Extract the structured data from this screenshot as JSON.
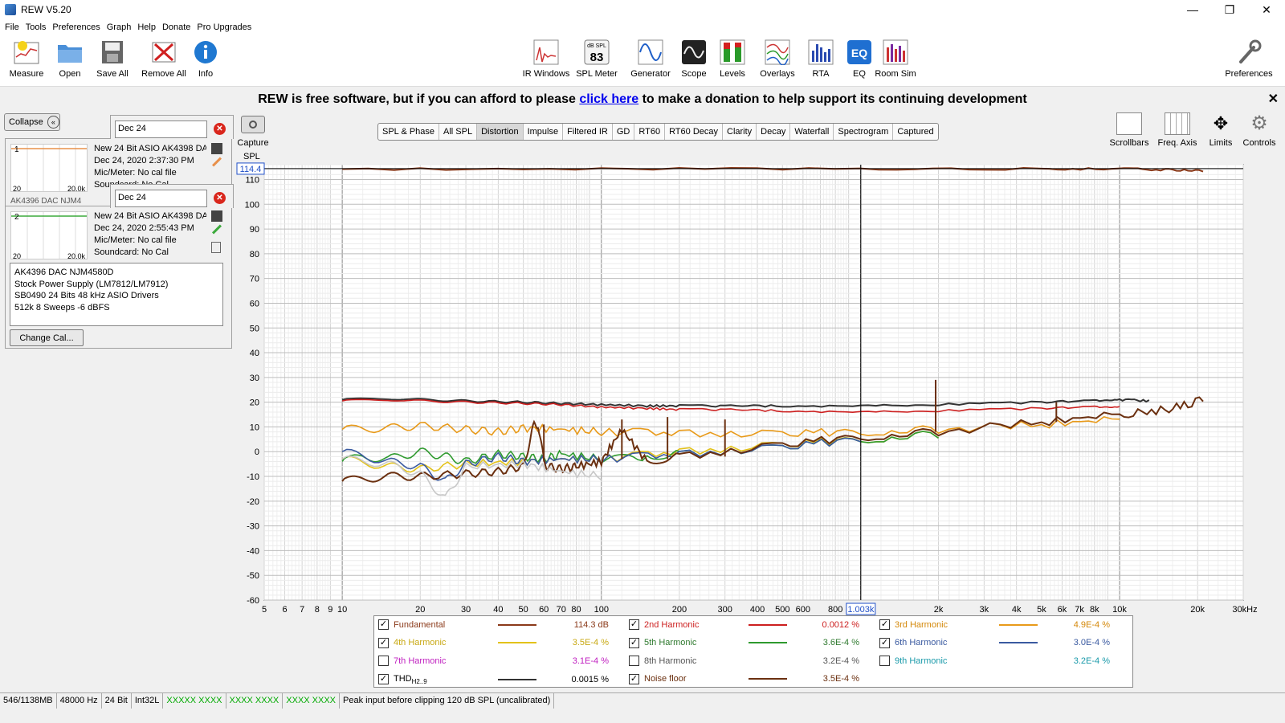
{
  "window": {
    "title": "REW V5.20",
    "controls": [
      "—",
      "❐",
      "✕"
    ]
  },
  "menu": [
    "File",
    "Tools",
    "Preferences",
    "Graph",
    "Help",
    "Donate",
    "Pro Upgrades"
  ],
  "toolbar_left": [
    "Measure",
    "Open",
    "Save All",
    "Remove All",
    "Info"
  ],
  "toolbar_center": [
    "IR Windows",
    "SPL Meter",
    "Generator",
    "Scope",
    "Levels",
    "Overlays",
    "RTA",
    "EQ",
    "Room Sim"
  ],
  "spl_meter_icon": {
    "unit": "dB SPL",
    "value": "83"
  },
  "preferences_label": "Preferences",
  "banner": {
    "before": "REW is free software, but if you can afford to please ",
    "link": "click here",
    "after": " to make a donation to help support its continuing development",
    "close": "✕"
  },
  "panel": {
    "collapse_label": "Collapse",
    "measurements": [
      {
        "name": "Dec 24",
        "index": "1",
        "thumb_min": "20",
        "thumb_max": "20.0k",
        "lines": [
          "New 24 Bit ASIO AK4398 DA",
          "Dec 24, 2020 2:37:30 PM",
          "Mic/Meter: No cal file",
          "Soundcard: No Cal"
        ],
        "trace_color": "#e8904a",
        "peek": "AK4396 DAC NJM4"
      },
      {
        "name": "Dec 24",
        "index": "2",
        "thumb_min": "20",
        "thumb_max": "20.0k",
        "lines": [
          "New 24 Bit ASIO AK4398 DA",
          "Dec 24, 2020 2:55:43 PM",
          "Mic/Meter: No cal file",
          "Soundcard: No Cal"
        ],
        "trace_color": "#3caa3c"
      }
    ],
    "notes": [
      "AK4396 DAC NJM4580D",
      "Stock Power Supply (LM7812/LM7912)",
      "SB0490 24 Bits 48 kHz ASIO Drivers",
      "512k 8 Sweeps -6 dBFS"
    ],
    "change_cal_label": "Change Cal..."
  },
  "capture_label": "Capture",
  "graph_tabs": [
    "SPL & Phase",
    "All SPL",
    "Distortion",
    "Impulse",
    "Filtered IR",
    "GD",
    "RT60",
    "RT60 Decay",
    "Clarity",
    "Decay",
    "Waterfall",
    "Spectrogram",
    "Captured"
  ],
  "active_tab": "Distortion",
  "right_tools": [
    "Scrollbars",
    "Freq. Axis",
    "Limits",
    "Controls"
  ],
  "chart_data": {
    "type": "line",
    "ylabel": "SPL",
    "xlim": [
      5,
      30000
    ],
    "ylim": [
      -60,
      116
    ],
    "xscale": "log",
    "x_ticks": [
      "5",
      "6",
      "7",
      "8",
      "9",
      "10",
      "20",
      "30",
      "40",
      "50",
      "60",
      "70",
      "80",
      "100",
      "200",
      "300",
      "400",
      "500",
      "600",
      "800",
      "2k",
      "3k",
      "4k",
      "5k",
      "6k",
      "7k",
      "8k",
      "10k",
      "20k",
      "30kHz"
    ],
    "x_tick_values": [
      5,
      6,
      7,
      8,
      9,
      10,
      20,
      30,
      40,
      50,
      60,
      70,
      80,
      100,
      200,
      300,
      400,
      500,
      600,
      800,
      2000,
      3000,
      4000,
      5000,
      6000,
      7000,
      8000,
      10000,
      20000,
      30000
    ],
    "y_ticks": [
      110,
      100,
      90,
      80,
      70,
      60,
      50,
      40,
      30,
      20,
      10,
      0,
      -10,
      -20,
      -30,
      -40,
      -50,
      -60
    ],
    "cursor": {
      "x": 1003,
      "x_label": "1.003k",
      "y": 114.4,
      "y_label": "114.4"
    },
    "grid": true,
    "series": [
      {
        "name": "Fundamental",
        "color": "#8b3a1a",
        "x": [
          10,
          100,
          1000,
          5000,
          10000,
          15000,
          21000
        ],
        "y": [
          114.2,
          114.3,
          114.3,
          114.3,
          114.3,
          114.0,
          113.4
        ]
      },
      {
        "name": "THD",
        "color": "#333333",
        "x": [
          10,
          15,
          20,
          30,
          50,
          70,
          100,
          150,
          200,
          300,
          500,
          1000,
          2000,
          5000,
          8000,
          10000,
          13000
        ],
        "y": [
          21,
          21.5,
          21,
          20.5,
          20,
          19.5,
          19,
          18.5,
          18.5,
          18.5,
          18.5,
          18.5,
          19,
          20,
          20.5,
          21,
          20.5
        ]
      },
      {
        "name": "2nd Harmonic",
        "color": "#cc1f1f",
        "x": [
          10,
          15,
          20,
          30,
          50,
          70,
          100,
          150,
          200,
          300,
          500,
          1000,
          2000,
          5000,
          8000,
          10000
        ],
        "y": [
          20.5,
          21,
          20.5,
          20,
          19.5,
          19,
          18,
          17.5,
          17,
          17,
          16.5,
          16,
          16.5,
          17.5,
          18,
          18
        ]
      },
      {
        "name": "3rd Harmonic",
        "color": "#e89a1a",
        "x": [
          10,
          15,
          20,
          30,
          40,
          50,
          70,
          100,
          200,
          500,
          1000,
          2000,
          5000,
          10000
        ],
        "y": [
          9,
          9.5,
          10.5,
          9,
          8,
          9.5,
          9,
          8,
          7.5,
          7.5,
          8,
          9,
          11,
          13
        ]
      },
      {
        "name": "4th Harmonic",
        "color": "#e3c21a",
        "x": [
          10,
          15,
          20,
          30,
          50,
          70,
          100,
          200,
          500,
          1000,
          2000
        ],
        "y": [
          -3,
          -6,
          -7,
          -5,
          -4,
          -3,
          -3,
          0,
          3,
          5,
          7
        ]
      },
      {
        "name": "5th Harmonic",
        "color": "#2f9a2f",
        "x": [
          10,
          12,
          15,
          20,
          25,
          30,
          40,
          50,
          60,
          70,
          100,
          150,
          200,
          500,
          1000,
          2000
        ],
        "y": [
          -4,
          -2,
          -3,
          0,
          -2,
          -4,
          -1,
          -2,
          -3,
          -1,
          -3,
          -2,
          -1,
          2,
          5,
          7
        ]
      },
      {
        "name": "6th Harmonic",
        "color": "#3a5aa0",
        "x": [
          10,
          15,
          20,
          25,
          30,
          40,
          50,
          70,
          100,
          200,
          500,
          1000
        ],
        "y": [
          0,
          -4,
          -6,
          -12,
          -5,
          -2,
          -4,
          -3,
          -3,
          -1,
          2,
          5
        ]
      },
      {
        "name": "Noise floor",
        "color": "#6b3010",
        "x": [
          10,
          12,
          15,
          20,
          30,
          40,
          50,
          55,
          57,
          60,
          62,
          70,
          80,
          100,
          120,
          150,
          200,
          500,
          1000,
          2000,
          5000,
          10000,
          15000,
          21000
        ],
        "y": [
          -12,
          -11,
          -10,
          -10,
          -9,
          -8,
          -6,
          11,
          11,
          -4,
          -6,
          -7,
          -6,
          -4,
          9,
          -4,
          -2,
          3,
          6,
          8,
          12,
          15,
          17,
          21
        ]
      },
      {
        "name": "Gray noise",
        "color": "#c8c8c8",
        "x": [
          10,
          15,
          20,
          25,
          30,
          50,
          70,
          100
        ],
        "y": [
          -3,
          -5,
          -9,
          -19,
          -6,
          -5,
          -8,
          -10
        ]
      }
    ],
    "spikes": [
      {
        "x": 60,
        "y_low": -4,
        "y_high": 11,
        "color": "#6b3010"
      },
      {
        "x": 120,
        "y_low": -3,
        "y_high": 13,
        "color": "#6b3010"
      },
      {
        "x": 180,
        "y_low": -3,
        "y_high": 14,
        "color": "#6b3010"
      },
      {
        "x": 300,
        "y_low": -2,
        "y_high": 13,
        "color": "#6b3010"
      },
      {
        "x": 1950,
        "y_low": 8,
        "y_high": 29,
        "color": "#6b3010"
      },
      {
        "x": 5700,
        "y_low": 12,
        "y_high": 20,
        "color": "#6b3010"
      }
    ]
  },
  "legend": [
    {
      "label": "Fundamental",
      "checked": true,
      "color": "#8b3a1a",
      "value": "114.3 dB",
      "label_color": "#8b3a1a",
      "value_color": "#8b3a1a"
    },
    {
      "label": "2nd Harmonic",
      "checked": true,
      "color": "#cc1f1f",
      "value": "0.0012 %",
      "label_color": "#cc1f1f",
      "value_color": "#cc1f1f"
    },
    {
      "label": "3rd Harmonic",
      "checked": true,
      "color": "#e89a1a",
      "value": "4.9E-4 %",
      "label_color": "#d4880a",
      "value_color": "#d4880a"
    },
    {
      "label": "4th Harmonic",
      "checked": true,
      "color": "#e3c21a",
      "value": "3.5E-4 %",
      "label_color": "#c8a812",
      "value_color": "#c8a812"
    },
    {
      "label": "5th Harmonic",
      "checked": true,
      "color": "#2f9a2f",
      "value": "3.6E-4 %",
      "label_color": "#2f7a2f",
      "value_color": "#2f7a2f"
    },
    {
      "label": "6th Harmonic",
      "checked": true,
      "color": "#3a5aa0",
      "value": "3.0E-4 %",
      "label_color": "#3a5aa0",
      "value_color": "#3a5aa0"
    },
    {
      "label": "7th Harmonic",
      "checked": false,
      "color": "",
      "value": "3.1E-4 %",
      "label_color": "#c020c0",
      "value_color": "#c020c0"
    },
    {
      "label": "8th Harmonic",
      "checked": false,
      "color": "",
      "value": "3.2E-4 %",
      "label_color": "#555555",
      "value_color": "#555555"
    },
    {
      "label": "9th Harmonic",
      "checked": false,
      "color": "",
      "value": "3.2E-4 %",
      "label_color": "#1a9aaa",
      "value_color": "#1a9aaa"
    },
    {
      "label": "THD",
      "sub": "H2..9",
      "checked": true,
      "color": "#333333",
      "value": "0.0015 %",
      "label_color": "#000000",
      "value_color": "#000000"
    },
    {
      "label": "Noise floor",
      "checked": true,
      "color": "#6b3010",
      "value": "3.5E-4 %",
      "label_color": "#6b3010",
      "value_color": "#6b3010"
    }
  ],
  "status": [
    "546/1138MB",
    "48000 Hz",
    "24 Bit",
    "Int32L",
    "XXXXX XXXX",
    "XXXX XXXX",
    "XXXX XXXX",
    "Peak input before clipping 120 dB SPL (uncalibrated)"
  ]
}
